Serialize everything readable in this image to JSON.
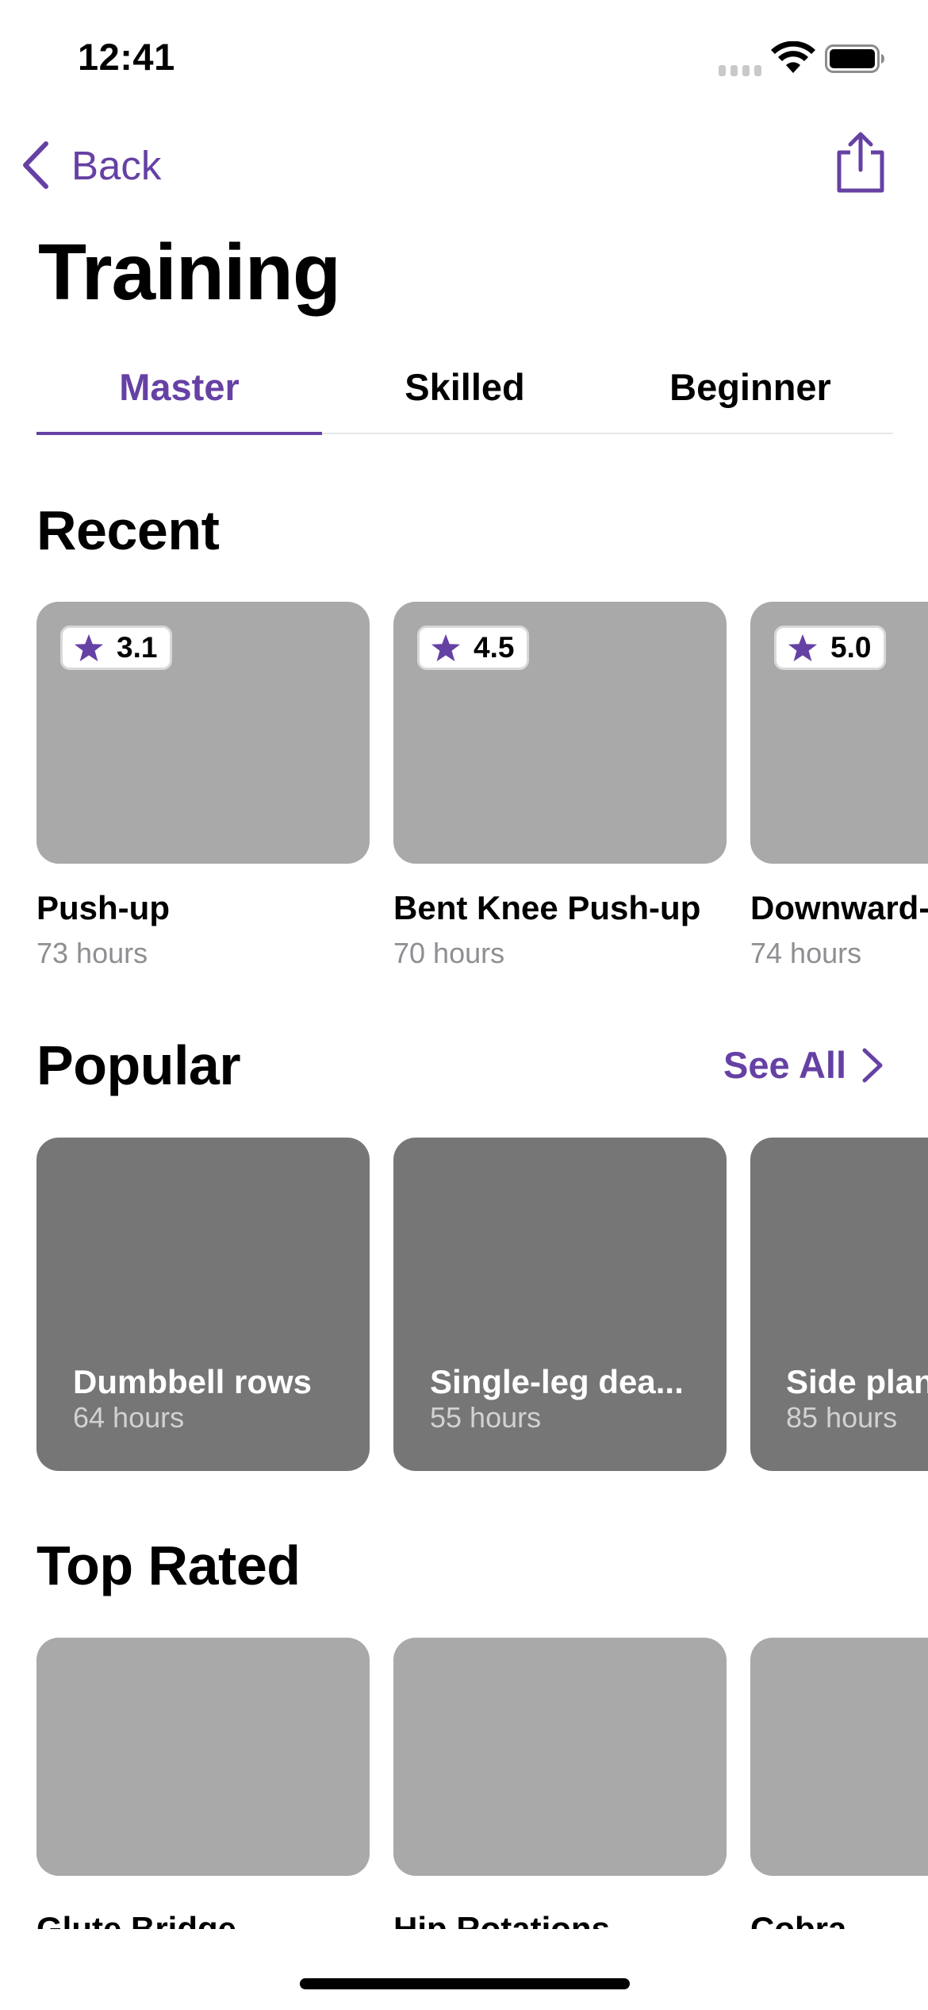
{
  "status_bar": {
    "time": "12:41"
  },
  "nav": {
    "back_label": "Back"
  },
  "page": {
    "title": "Training"
  },
  "tabs": [
    {
      "label": "Master",
      "selected": true
    },
    {
      "label": "Skilled",
      "selected": false
    },
    {
      "label": "Beginner",
      "selected": false
    }
  ],
  "recent": {
    "title": "Recent",
    "items": [
      {
        "rating": "3.1",
        "name": "Push-up",
        "duration": "73 hours"
      },
      {
        "rating": "4.5",
        "name": "Bent Knee Push-up",
        "duration": "70 hours"
      },
      {
        "rating": "5.0",
        "name": "Downward-",
        "duration": "74 hours"
      }
    ]
  },
  "popular": {
    "title": "Popular",
    "see_all": "See All",
    "items": [
      {
        "name": "Dumbbell rows",
        "duration": "64 hours"
      },
      {
        "name": "Single-leg dea...",
        "duration": "55 hours"
      },
      {
        "name": "Side plan",
        "duration": "85 hours"
      }
    ]
  },
  "top_rated": {
    "title": "Top Rated",
    "items": [
      {
        "name": "Glute Bridge"
      },
      {
        "name": "Hip Rotations"
      },
      {
        "name": "Cobra"
      }
    ]
  },
  "colors": {
    "accent": "#6641A4",
    "card_light": "#A9A9A9",
    "card_dark": "#767676",
    "secondary_text": "#8E8E93"
  },
  "icons": [
    "signal-icon",
    "wifi-icon",
    "battery-icon",
    "back-chevron-icon",
    "share-icon",
    "star-icon",
    "chevron-right-icon"
  ]
}
